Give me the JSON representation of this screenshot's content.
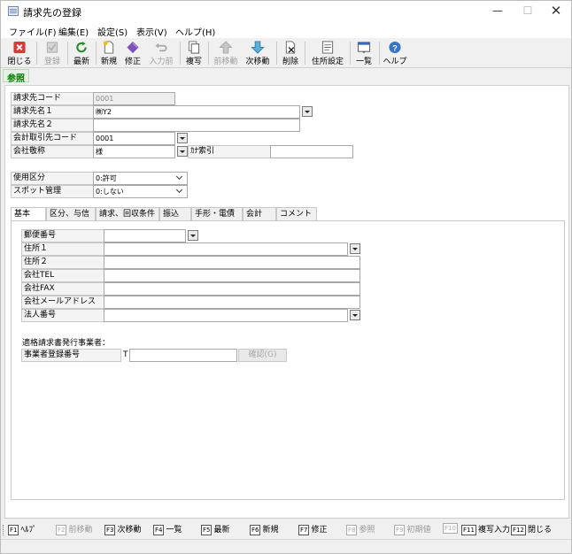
{
  "window": {
    "title": "請求先の登録"
  },
  "menu": [
    "ファイル(F)",
    "編集(E)",
    "設定(S)",
    "表示(V)",
    "ヘルプ(H)"
  ],
  "toolbar": {
    "close": "閉じる",
    "register": "登録",
    "refresh": "最新",
    "new": "新規",
    "edit": "修正",
    "before_input": "入力前",
    "copy": "複写",
    "prev": "前移動",
    "next": "次移動",
    "delete": "削除",
    "address_settings": "住所設定",
    "list": "一覧",
    "help": "ヘルプ"
  },
  "mode": "参照",
  "form": {
    "billing_code_label": "請求先コード",
    "billing_code": "0001",
    "billing_name1_label": "請求先名１",
    "billing_name1": "㈱Y2",
    "billing_name2_label": "請求先名２",
    "billing_name2": "",
    "account_code_label": "会計取引先コード",
    "account_code": "0001",
    "honorific_label": "会社敬称",
    "honorific": "様",
    "kana_label": "ｶﾅ索引",
    "kana": "",
    "usage_label": "使用区分",
    "usage": "0:許可",
    "spot_label": "スポット管理",
    "spot": "0:しない"
  },
  "tabs": [
    "基本",
    "区分、与信",
    "請求、回収条件",
    "振込",
    "手形・電債",
    "会計",
    "コメント"
  ],
  "basic": {
    "postal_label": "郵便番号",
    "postal": "",
    "address1_label": "住所１",
    "address1": "",
    "address2_label": "住所２",
    "address2": "",
    "tel_label": "会社TEL",
    "tel": "",
    "fax_label": "会社FAX",
    "fax": "",
    "email_label": "会社メールアドレス",
    "email": "",
    "corp_number_label": "法人番号",
    "corp_number": "",
    "invoice_section_title": "適格請求書発行事業者：",
    "registration_label": "事業者登録番号",
    "registration_prefix": "T",
    "registration": "",
    "confirm_button": "確認(G)"
  },
  "fkeys": [
    {
      "key": "F1",
      "label": "ﾍﾙﾌﾟ"
    },
    {
      "key": "F2",
      "label": "前移動"
    },
    {
      "key": "F3",
      "label": "次移動"
    },
    {
      "key": "F4",
      "label": "一覧"
    },
    {
      "key": "F5",
      "label": "最新"
    },
    {
      "key": "F6",
      "label": "新規"
    },
    {
      "key": "F7",
      "label": "修正"
    },
    {
      "key": "F8",
      "label": "参照"
    },
    {
      "key": "F9",
      "label": "初期値"
    },
    {
      "key": "F10",
      "label": ""
    },
    {
      "key": "F11",
      "label": "複写入力"
    },
    {
      "key": "F12",
      "label": "閉じる"
    }
  ],
  "colors": {
    "mode_text": "#008000",
    "disabled_text": "#a0a0a0"
  }
}
